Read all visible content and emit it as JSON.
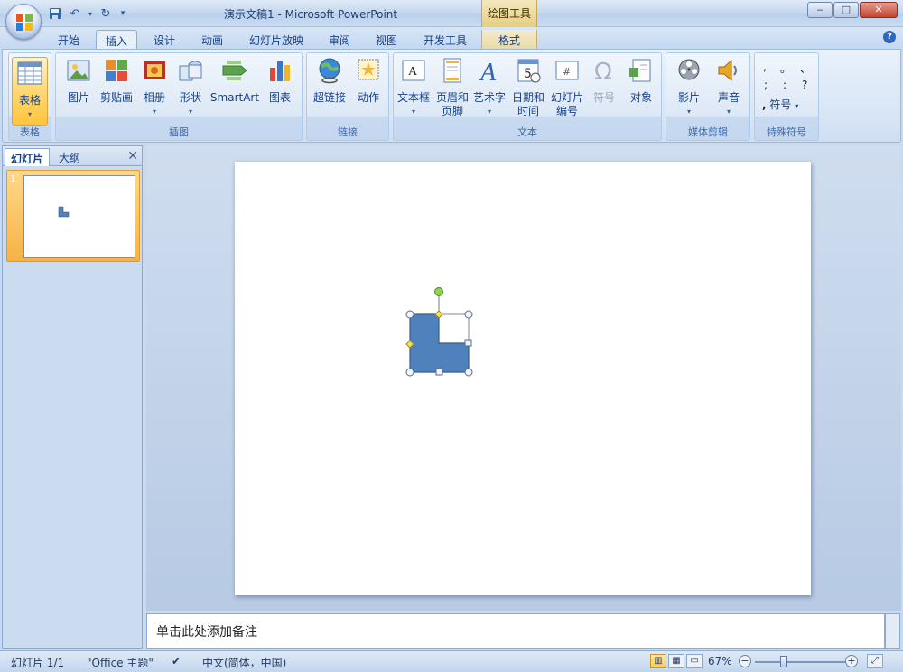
{
  "window": {
    "title": "演示文稿1 - Microsoft PowerPoint",
    "context_tools_label": "绘图工具",
    "minimize": "‒",
    "maximize": "□",
    "close": "✕"
  },
  "tabs": [
    {
      "label": "开始"
    },
    {
      "label": "插入"
    },
    {
      "label": "设计"
    },
    {
      "label": "动画"
    },
    {
      "label": "幻灯片放映"
    },
    {
      "label": "审阅"
    },
    {
      "label": "视图"
    },
    {
      "label": "开发工具"
    },
    {
      "label": "格式"
    }
  ],
  "ribbon": {
    "groups": {
      "table": "表格",
      "illustrations": "插图",
      "links": "链接",
      "text": "文本",
      "media": "媒体剪辑",
      "special": "特殊符号"
    },
    "buttons": {
      "table": "表格",
      "picture": "图片",
      "clipart": "剪贴画",
      "album": "相册",
      "shapes": "形状",
      "smartart": "SmartArt",
      "chart": "图表",
      "hyperlink": "超链接",
      "action": "动作",
      "textbox": "文本框",
      "header_footer_1": "页眉和",
      "header_footer_2": "页脚",
      "wordart": "艺术字",
      "datetime_1": "日期和",
      "datetime_2": "时间",
      "slide_number_1": "幻灯片",
      "slide_number_2": "编号",
      "symbol": "符号",
      "object": "对象",
      "movie": "影片",
      "sound": "声音",
      "special_symbol": "符号"
    },
    "special_symbols": [
      ",",
      "。",
      "、",
      ";",
      ":",
      "?"
    ]
  },
  "pane": {
    "tab_slides": "幻灯片",
    "tab_outline": "大纲",
    "slide_number": "1"
  },
  "notes": {
    "placeholder": "单击此处添加备注"
  },
  "status": {
    "slide": "幻灯片 1/1",
    "theme": "\"Office 主题\"",
    "language": "中文(简体，中国)",
    "zoom": "67%"
  },
  "colors": {
    "shape_fill": "#4f81bd",
    "shape_stroke": "#385d8a",
    "accent_tab": "#e8d9a5"
  }
}
